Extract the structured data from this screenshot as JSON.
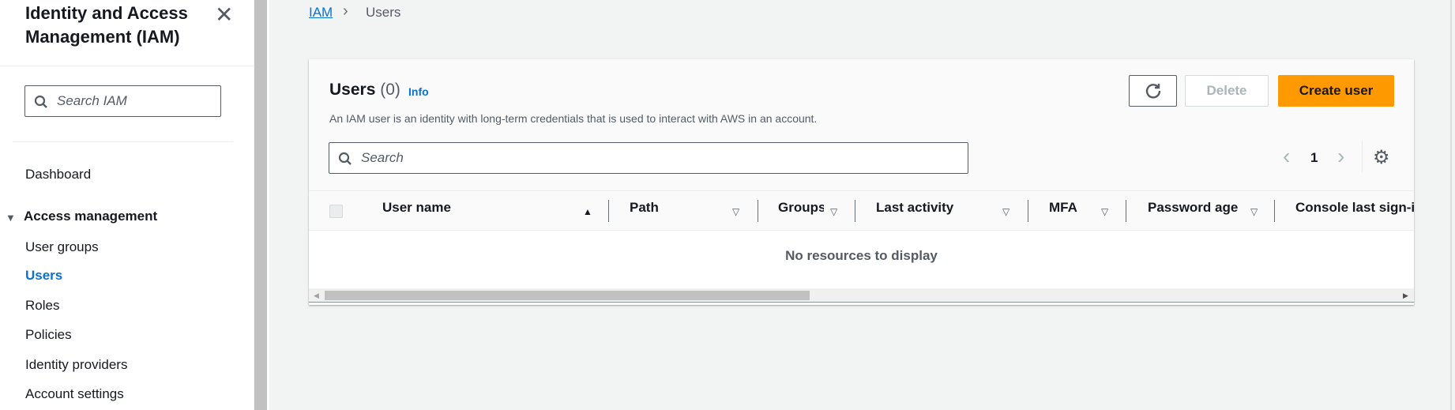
{
  "sidebar": {
    "title": "Identity and Access Management (IAM)",
    "search_placeholder": "Search IAM",
    "dashboard": "Dashboard",
    "section": "Access management",
    "items": [
      "User groups",
      "Users",
      "Roles",
      "Policies",
      "Identity providers",
      "Account settings"
    ],
    "active": "Users"
  },
  "breadcrumb": [
    "IAM",
    "Users"
  ],
  "panel": {
    "title": "Users",
    "count": "(0)",
    "info": "Info",
    "description": "An IAM user is an identity with long-term credentials that is used to interact with AWS in an account.",
    "delete_label": "Delete",
    "create_label": "Create user",
    "search_placeholder": "Search",
    "page": "1"
  },
  "table": {
    "columns": [
      "User name",
      "Path",
      "Groups",
      "Last activity",
      "MFA",
      "Password age",
      "Console last sign-in"
    ],
    "empty": "No resources to display"
  },
  "colors": {
    "accent": "#ff9900",
    "link": "#0972d3"
  }
}
